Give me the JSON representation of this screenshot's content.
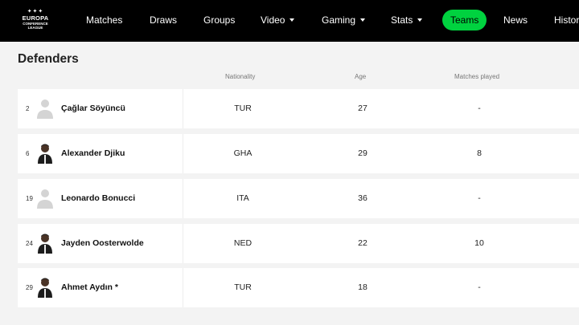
{
  "nav": {
    "logo": {
      "line1": "EUROPA",
      "line2": "CONFERENCE",
      "line3": "LEAGUE"
    },
    "items": [
      {
        "label": "Matches",
        "dropdown": false,
        "active": false
      },
      {
        "label": "Draws",
        "dropdown": false,
        "active": false
      },
      {
        "label": "Groups",
        "dropdown": false,
        "active": false
      },
      {
        "label": "Video",
        "dropdown": true,
        "active": false
      },
      {
        "label": "Gaming",
        "dropdown": true,
        "active": false
      },
      {
        "label": "Stats",
        "dropdown": true,
        "active": false
      },
      {
        "label": "Teams",
        "dropdown": false,
        "active": true
      },
      {
        "label": "News",
        "dropdown": false,
        "active": false
      },
      {
        "label": "History",
        "dropdown": false,
        "active": false
      }
    ]
  },
  "section": {
    "title": "Defenders",
    "columns": {
      "nationality": "Nationality",
      "age": "Age",
      "matches_played": "Matches played"
    }
  },
  "players": [
    {
      "number": "2",
      "name": "Çağlar Söyüncü",
      "nationality": "TUR",
      "age": "27",
      "matches_played": "-",
      "photo": "placeholder"
    },
    {
      "number": "6",
      "name": "Alexander Djiku",
      "nationality": "GHA",
      "age": "29",
      "matches_played": "8",
      "photo": "photo"
    },
    {
      "number": "19",
      "name": "Leonardo Bonucci",
      "nationality": "ITA",
      "age": "36",
      "matches_played": "-",
      "photo": "placeholder"
    },
    {
      "number": "24",
      "name": "Jayden Oosterwolde",
      "nationality": "NED",
      "age": "22",
      "matches_played": "10",
      "photo": "photo"
    },
    {
      "number": "29",
      "name": "Ahmet Aydın *",
      "nationality": "TUR",
      "age": "18",
      "matches_played": "-",
      "photo": "photo"
    }
  ],
  "colors": {
    "accent": "#00d23f",
    "nav_bg": "#000000",
    "page_bg": "#f3f3f3"
  }
}
